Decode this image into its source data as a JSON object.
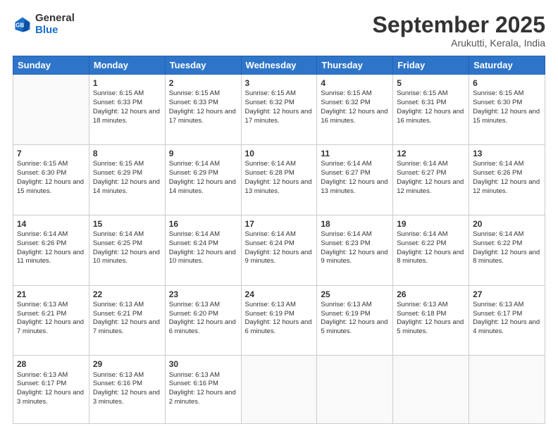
{
  "header": {
    "logo": {
      "line1": "General",
      "line2": "Blue"
    },
    "title": "September 2025",
    "location": "Arukutti, Kerala, India"
  },
  "days_of_week": [
    "Sunday",
    "Monday",
    "Tuesday",
    "Wednesday",
    "Thursday",
    "Friday",
    "Saturday"
  ],
  "weeks": [
    [
      {
        "day": null
      },
      {
        "day": "1",
        "sunrise": "Sunrise: 6:15 AM",
        "sunset": "Sunset: 6:33 PM",
        "daylight": "Daylight: 12 hours and 18 minutes."
      },
      {
        "day": "2",
        "sunrise": "Sunrise: 6:15 AM",
        "sunset": "Sunset: 6:33 PM",
        "daylight": "Daylight: 12 hours and 17 minutes."
      },
      {
        "day": "3",
        "sunrise": "Sunrise: 6:15 AM",
        "sunset": "Sunset: 6:32 PM",
        "daylight": "Daylight: 12 hours and 17 minutes."
      },
      {
        "day": "4",
        "sunrise": "Sunrise: 6:15 AM",
        "sunset": "Sunset: 6:32 PM",
        "daylight": "Daylight: 12 hours and 16 minutes."
      },
      {
        "day": "5",
        "sunrise": "Sunrise: 6:15 AM",
        "sunset": "Sunset: 6:31 PM",
        "daylight": "Daylight: 12 hours and 16 minutes."
      },
      {
        "day": "6",
        "sunrise": "Sunrise: 6:15 AM",
        "sunset": "Sunset: 6:30 PM",
        "daylight": "Daylight: 12 hours and 15 minutes."
      }
    ],
    [
      {
        "day": "7",
        "sunrise": "Sunrise: 6:15 AM",
        "sunset": "Sunset: 6:30 PM",
        "daylight": "Daylight: 12 hours and 15 minutes."
      },
      {
        "day": "8",
        "sunrise": "Sunrise: 6:15 AM",
        "sunset": "Sunset: 6:29 PM",
        "daylight": "Daylight: 12 hours and 14 minutes."
      },
      {
        "day": "9",
        "sunrise": "Sunrise: 6:14 AM",
        "sunset": "Sunset: 6:29 PM",
        "daylight": "Daylight: 12 hours and 14 minutes."
      },
      {
        "day": "10",
        "sunrise": "Sunrise: 6:14 AM",
        "sunset": "Sunset: 6:28 PM",
        "daylight": "Daylight: 12 hours and 13 minutes."
      },
      {
        "day": "11",
        "sunrise": "Sunrise: 6:14 AM",
        "sunset": "Sunset: 6:27 PM",
        "daylight": "Daylight: 12 hours and 13 minutes."
      },
      {
        "day": "12",
        "sunrise": "Sunrise: 6:14 AM",
        "sunset": "Sunset: 6:27 PM",
        "daylight": "Daylight: 12 hours and 12 minutes."
      },
      {
        "day": "13",
        "sunrise": "Sunrise: 6:14 AM",
        "sunset": "Sunset: 6:26 PM",
        "daylight": "Daylight: 12 hours and 12 minutes."
      }
    ],
    [
      {
        "day": "14",
        "sunrise": "Sunrise: 6:14 AM",
        "sunset": "Sunset: 6:26 PM",
        "daylight": "Daylight: 12 hours and 11 minutes."
      },
      {
        "day": "15",
        "sunrise": "Sunrise: 6:14 AM",
        "sunset": "Sunset: 6:25 PM",
        "daylight": "Daylight: 12 hours and 10 minutes."
      },
      {
        "day": "16",
        "sunrise": "Sunrise: 6:14 AM",
        "sunset": "Sunset: 6:24 PM",
        "daylight": "Daylight: 12 hours and 10 minutes."
      },
      {
        "day": "17",
        "sunrise": "Sunrise: 6:14 AM",
        "sunset": "Sunset: 6:24 PM",
        "daylight": "Daylight: 12 hours and 9 minutes."
      },
      {
        "day": "18",
        "sunrise": "Sunrise: 6:14 AM",
        "sunset": "Sunset: 6:23 PM",
        "daylight": "Daylight: 12 hours and 9 minutes."
      },
      {
        "day": "19",
        "sunrise": "Sunrise: 6:14 AM",
        "sunset": "Sunset: 6:22 PM",
        "daylight": "Daylight: 12 hours and 8 minutes."
      },
      {
        "day": "20",
        "sunrise": "Sunrise: 6:14 AM",
        "sunset": "Sunset: 6:22 PM",
        "daylight": "Daylight: 12 hours and 8 minutes."
      }
    ],
    [
      {
        "day": "21",
        "sunrise": "Sunrise: 6:13 AM",
        "sunset": "Sunset: 6:21 PM",
        "daylight": "Daylight: 12 hours and 7 minutes."
      },
      {
        "day": "22",
        "sunrise": "Sunrise: 6:13 AM",
        "sunset": "Sunset: 6:21 PM",
        "daylight": "Daylight: 12 hours and 7 minutes."
      },
      {
        "day": "23",
        "sunrise": "Sunrise: 6:13 AM",
        "sunset": "Sunset: 6:20 PM",
        "daylight": "Daylight: 12 hours and 6 minutes."
      },
      {
        "day": "24",
        "sunrise": "Sunrise: 6:13 AM",
        "sunset": "Sunset: 6:19 PM",
        "daylight": "Daylight: 12 hours and 6 minutes."
      },
      {
        "day": "25",
        "sunrise": "Sunrise: 6:13 AM",
        "sunset": "Sunset: 6:19 PM",
        "daylight": "Daylight: 12 hours and 5 minutes."
      },
      {
        "day": "26",
        "sunrise": "Sunrise: 6:13 AM",
        "sunset": "Sunset: 6:18 PM",
        "daylight": "Daylight: 12 hours and 5 minutes."
      },
      {
        "day": "27",
        "sunrise": "Sunrise: 6:13 AM",
        "sunset": "Sunset: 6:17 PM",
        "daylight": "Daylight: 12 hours and 4 minutes."
      }
    ],
    [
      {
        "day": "28",
        "sunrise": "Sunrise: 6:13 AM",
        "sunset": "Sunset: 6:17 PM",
        "daylight": "Daylight: 12 hours and 3 minutes."
      },
      {
        "day": "29",
        "sunrise": "Sunrise: 6:13 AM",
        "sunset": "Sunset: 6:16 PM",
        "daylight": "Daylight: 12 hours and 3 minutes."
      },
      {
        "day": "30",
        "sunrise": "Sunrise: 6:13 AM",
        "sunset": "Sunset: 6:16 PM",
        "daylight": "Daylight: 12 hours and 2 minutes."
      },
      {
        "day": null
      },
      {
        "day": null
      },
      {
        "day": null
      },
      {
        "day": null
      }
    ]
  ]
}
